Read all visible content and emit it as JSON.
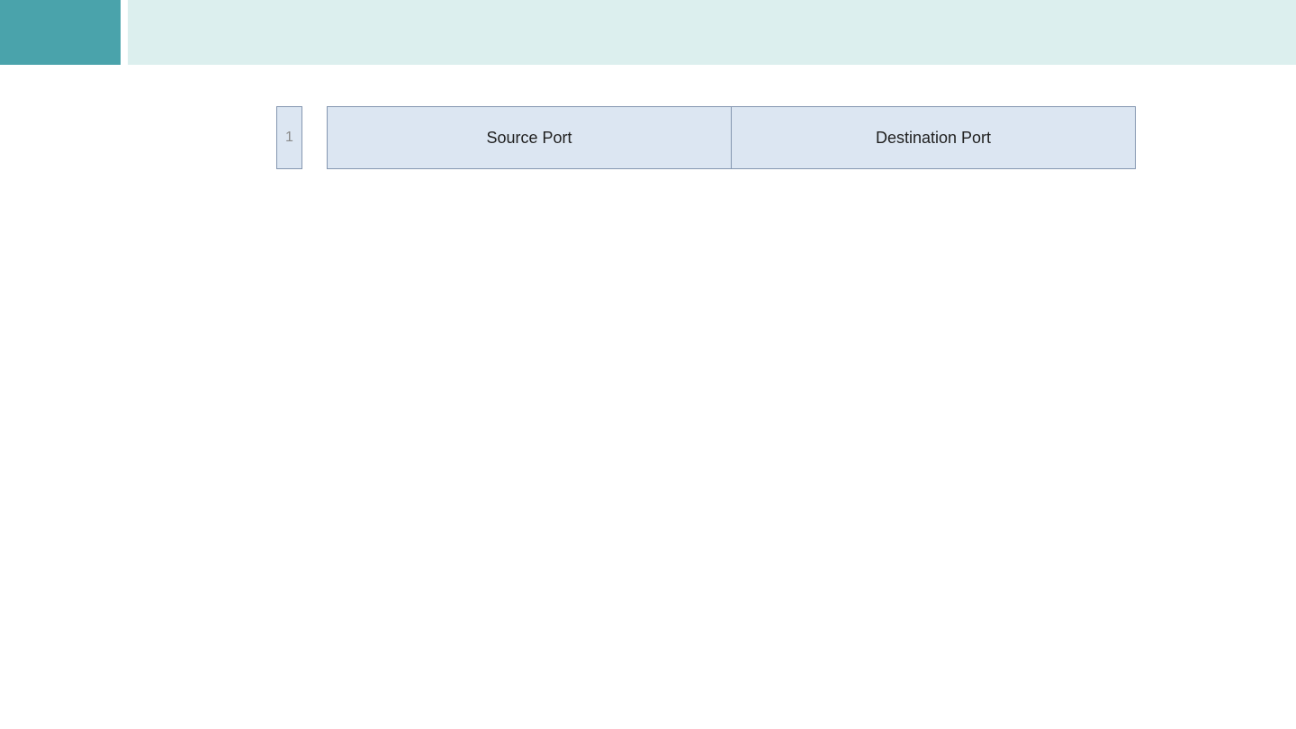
{
  "colors": {
    "accent": "#4aa3ab",
    "band": "#dcefee",
    "cell_fill": "#dce6f2",
    "number_text": "#8a8a8a"
  },
  "header": {
    "title": ""
  },
  "diagram": {
    "row_number": "1",
    "fields": [
      {
        "label": "Source Port"
      },
      {
        "label": "Destination Port"
      }
    ]
  }
}
